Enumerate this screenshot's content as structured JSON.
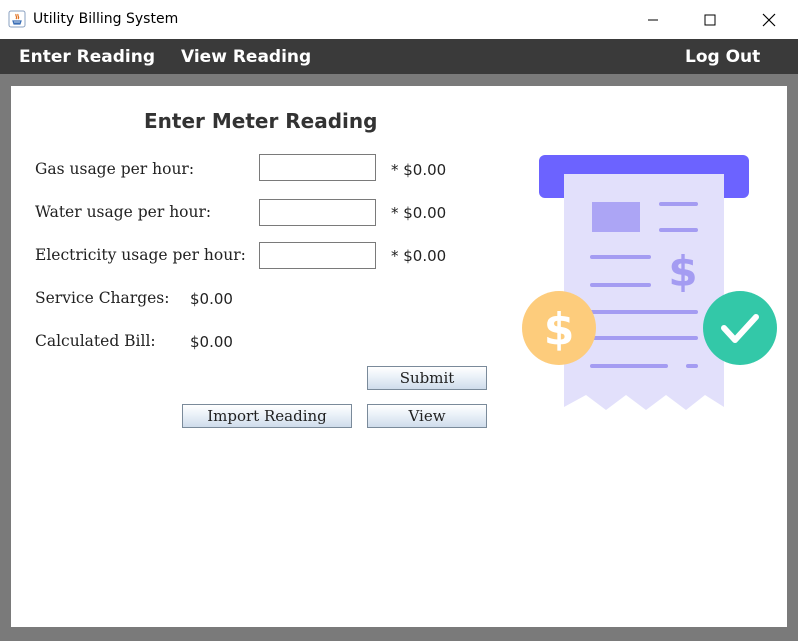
{
  "window": {
    "title": "Utility Billing System"
  },
  "menu": {
    "enter_reading": "Enter Reading",
    "view_reading": "View Reading",
    "log_out": "Log Out"
  },
  "form": {
    "heading": "Enter Meter Reading",
    "gas_label": "Gas usage per hour:",
    "gas_value": "",
    "gas_cost": "* $0.00",
    "water_label": "Water usage per hour:",
    "water_value": "",
    "water_cost": "* $0.00",
    "electricity_label": "Electricity usage per hour:",
    "electricity_value": "",
    "electricity_cost": "* $0.00",
    "service_label": "Service Charges:",
    "service_value": "$0.00",
    "bill_label": "Calculated Bill:",
    "bill_value": "$0.00"
  },
  "buttons": {
    "submit": "Submit",
    "import": "Import Reading",
    "view": "View"
  },
  "illustration": {
    "icon": "receipt-dollar-check-illustration",
    "left_badge": "$",
    "receipt_symbol": "$"
  },
  "colors": {
    "menubar": "#3a3a3a",
    "accent": "#6c63ff",
    "receipt": "#e2e0fb",
    "coin": "#fdcc7c",
    "check": "#33c8a8",
    "lines": "#a49cf2"
  }
}
